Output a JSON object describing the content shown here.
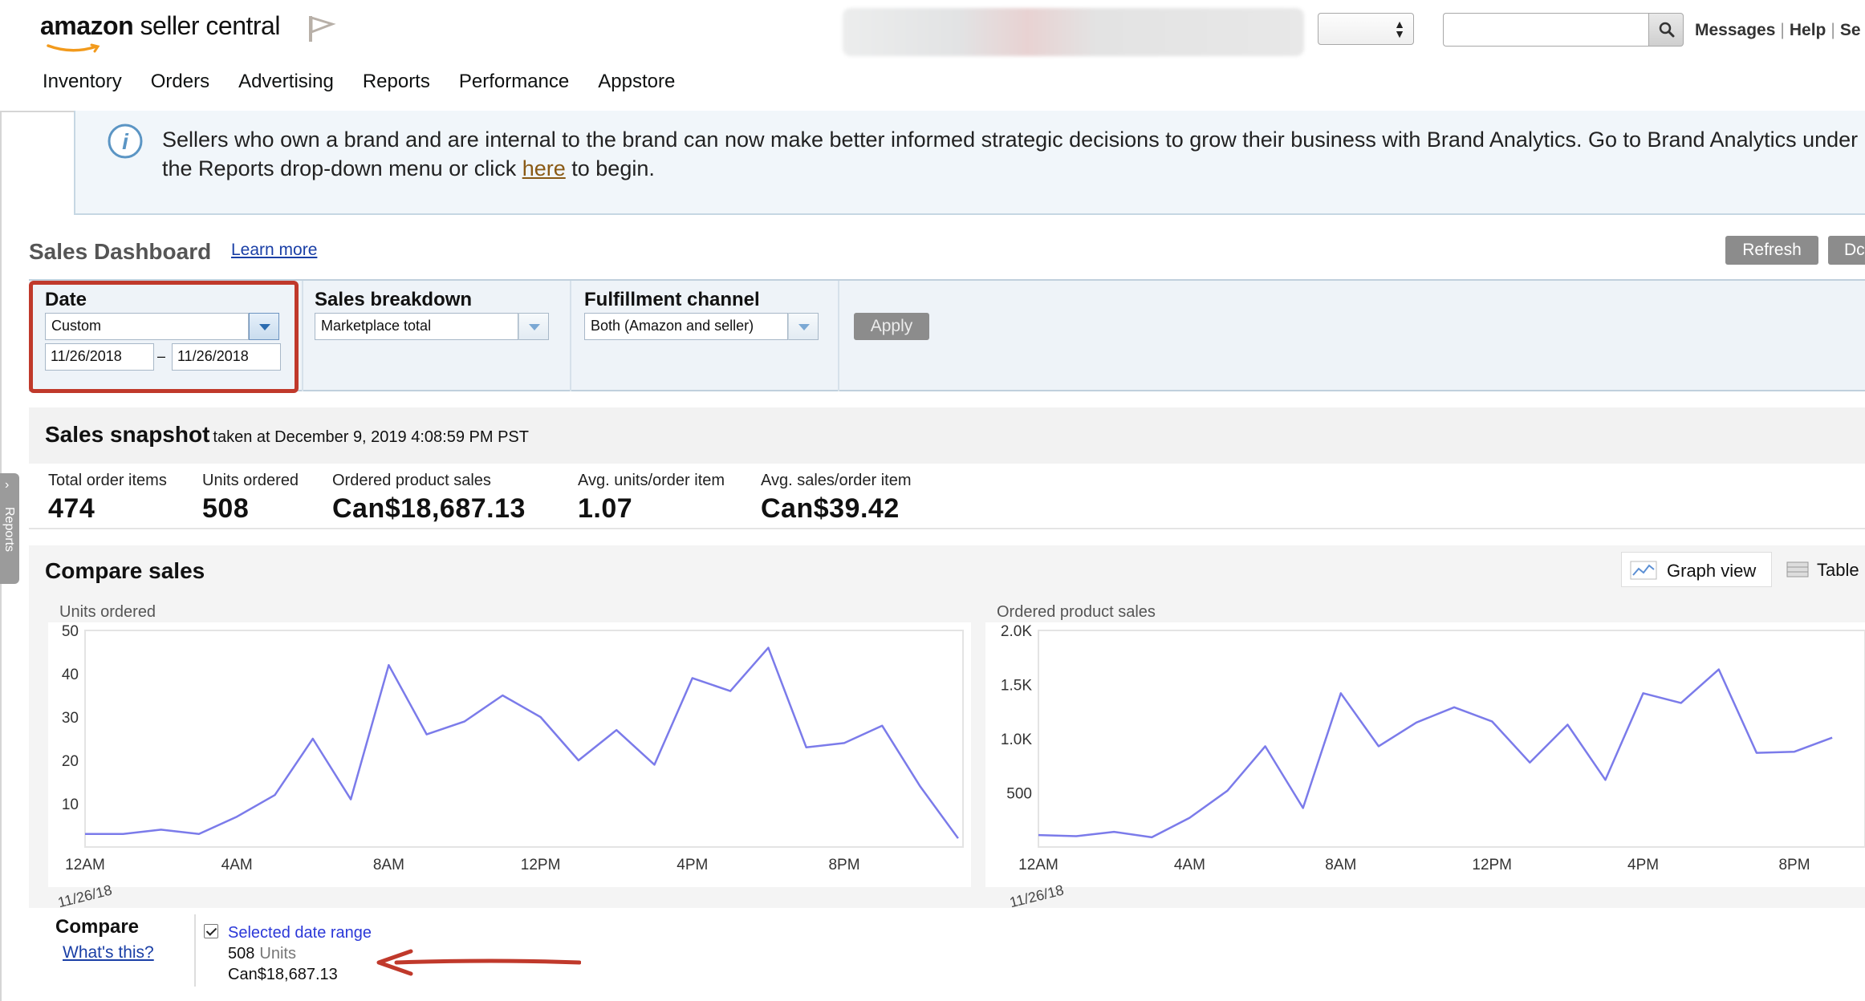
{
  "header": {
    "logo_text_bold": "amazon",
    "logo_text_regular": " seller central",
    "flag_icon": "flag-icon",
    "search_icon": "search-icon",
    "links": [
      "Messages",
      "Help",
      "Se"
    ]
  },
  "nav": {
    "items": [
      "Inventory",
      "Orders",
      "Advertising",
      "Reports",
      "Performance",
      "Appstore"
    ]
  },
  "banner": {
    "icon": "info-icon",
    "text_before": "Sellers who own a brand and are internal to the brand can now make better informed strategic decisions to grow their business with Brand Analytics. Go to Brand Analytics under the Reports drop-down menu or click ",
    "link": "here",
    "text_after": " to begin."
  },
  "dashboard": {
    "title": "Sales Dashboard",
    "learn_more": "Learn more",
    "refresh": "Refresh",
    "download": "Dc"
  },
  "filters": {
    "date_label": "Date",
    "date_value": "Custom",
    "date_from": "11/26/2018",
    "date_dash": "–",
    "date_to": "11/26/2018",
    "breakdown_label": "Sales breakdown",
    "breakdown_value": "Marketplace total",
    "fulfillment_label": "Fulfillment channel",
    "fulfillment_value": "Both (Amazon and seller)",
    "apply": "Apply"
  },
  "snapshot": {
    "title": "Sales snapshot",
    "subtitle": "taken at December 9, 2019 4:08:59 PM PST",
    "metrics": [
      {
        "label": "Total order items",
        "value": "474"
      },
      {
        "label": "Units ordered",
        "value": "508"
      },
      {
        "label": "Ordered product sales",
        "value": "Can$18,687.13"
      },
      {
        "label": "Avg. units/order item",
        "value": "1.07"
      },
      {
        "label": "Avg. sales/order item",
        "value": "Can$39.42"
      }
    ]
  },
  "compare": {
    "title": "Compare sales",
    "graph_view": "Graph view",
    "table_view": "Table",
    "graph_icon": "line-chart-icon",
    "table_icon": "table-icon",
    "compare_label": "Compare",
    "whats_this": "What's this?",
    "range_label": "Selected date range",
    "range_units_value": "508",
    "range_units_word": "Units",
    "range_sales": "Can$18,687.13",
    "date_stamp": "11/26/18"
  },
  "side_tab": {
    "label": "Reports"
  },
  "colors": {
    "line": "#7b7bea",
    "highlight": "#c0392b",
    "link": "#1a3fa6"
  },
  "chart_data": [
    {
      "type": "line",
      "title": "Units ordered",
      "x_ticks": [
        "12AM",
        "4AM",
        "8AM",
        "12PM",
        "4PM",
        "8PM"
      ],
      "y_ticks": [
        "10",
        "20",
        "30",
        "40",
        "50"
      ],
      "ylim": [
        0,
        50
      ],
      "x": [
        0,
        1,
        2,
        3,
        4,
        5,
        6,
        7,
        8,
        9,
        10,
        11,
        12,
        13,
        14,
        15,
        16,
        17,
        18,
        19,
        20,
        21,
        22,
        23
      ],
      "series": [
        {
          "values": [
            3,
            3,
            4,
            3,
            7,
            12,
            25,
            11,
            42,
            26,
            29,
            35,
            30,
            20,
            27,
            19,
            39,
            36,
            46,
            23,
            24,
            28,
            14,
            2
          ]
        }
      ]
    },
    {
      "type": "line",
      "title": "Ordered product sales",
      "x_ticks": [
        "12AM",
        "4AM",
        "8AM",
        "12PM",
        "4PM",
        "8PM"
      ],
      "y_ticks": [
        "500",
        "1.0K",
        "1.5K",
        "2.0K"
      ],
      "ylim": [
        0,
        2000
      ],
      "x": [
        0,
        1,
        2,
        3,
        4,
        5,
        6,
        7,
        8,
        9,
        10,
        11,
        12,
        13,
        14,
        15,
        16,
        17,
        18,
        19,
        20,
        21
      ],
      "series": [
        {
          "values": [
            110,
            100,
            140,
            90,
            270,
            520,
            930,
            360,
            1420,
            930,
            1150,
            1290,
            1160,
            780,
            1130,
            620,
            1420,
            1330,
            1640,
            870,
            880,
            1010
          ]
        }
      ]
    }
  ]
}
